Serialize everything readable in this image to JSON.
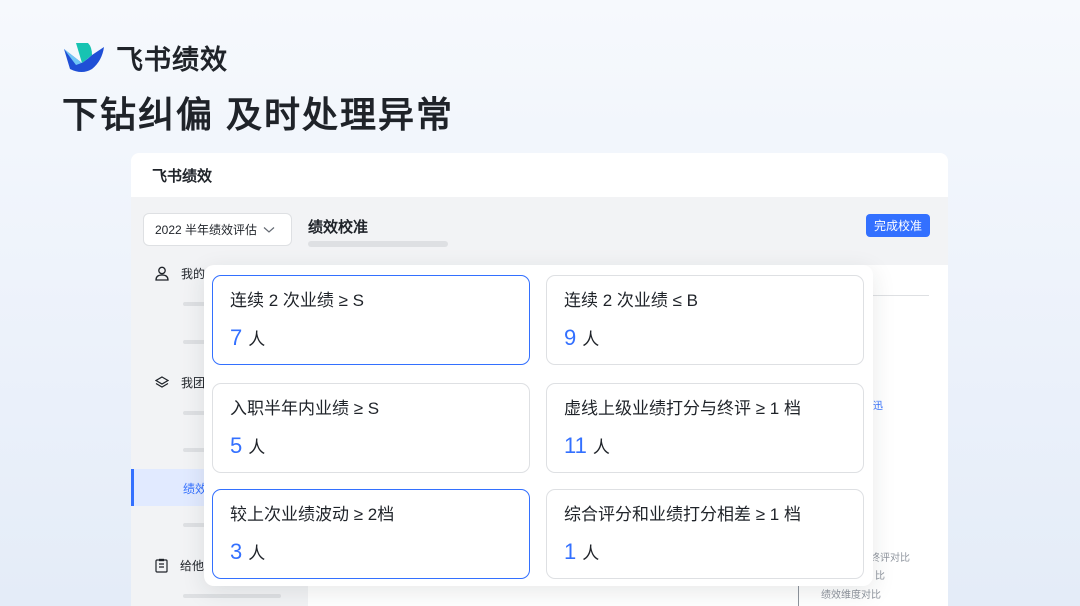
{
  "brand": {
    "name": "飞书绩效",
    "logo_icon": "feishu-bird-logo"
  },
  "headline": "下钻纠偏 及时处理异常",
  "app": {
    "header_title": "飞书绩效",
    "period_select": {
      "value": "2022 半年绩效评估",
      "icon": "chevron-down-icon"
    },
    "section_title": "绩效校准",
    "complete_button": "完成校准",
    "sidebar": [
      {
        "label": "我的",
        "icon": "user-icon"
      },
      {
        "label": "我团",
        "icon": "layers-icon"
      },
      {
        "label": "绩效",
        "active": true
      },
      {
        "label": "给他",
        "icon": "clipboard-icon"
      }
    ],
    "right_panel": {
      "link_text": "迅",
      "line1": "终评对比",
      "line2": "比",
      "line3": "绩效维度对比"
    }
  },
  "overlay": {
    "cards": [
      {
        "title": "连续 2 次业绩 ≥ S",
        "value": "7",
        "unit": "人",
        "selected": true
      },
      {
        "title": "连续 2 次业绩 ≤ B",
        "value": "9",
        "unit": "人",
        "selected": false
      },
      {
        "title": "入职半年内业绩 ≥ S",
        "value": "5",
        "unit": "人",
        "selected": false
      },
      {
        "title": "虚线上级业绩打分与终评 ≥ 1 档",
        "value": "11",
        "unit": "人",
        "selected": false
      },
      {
        "title": "较上次业绩波动 ≥ 2档",
        "value": "3",
        "unit": "人",
        "selected": true
      },
      {
        "title": "综合评分和业绩打分相差 ≥ 1 档",
        "value": "1",
        "unit": "人",
        "selected": false
      }
    ]
  },
  "colors": {
    "accent": "#3370ff",
    "text": "#1f2329",
    "muted": "#8f959e",
    "border": "#dee0e3"
  }
}
